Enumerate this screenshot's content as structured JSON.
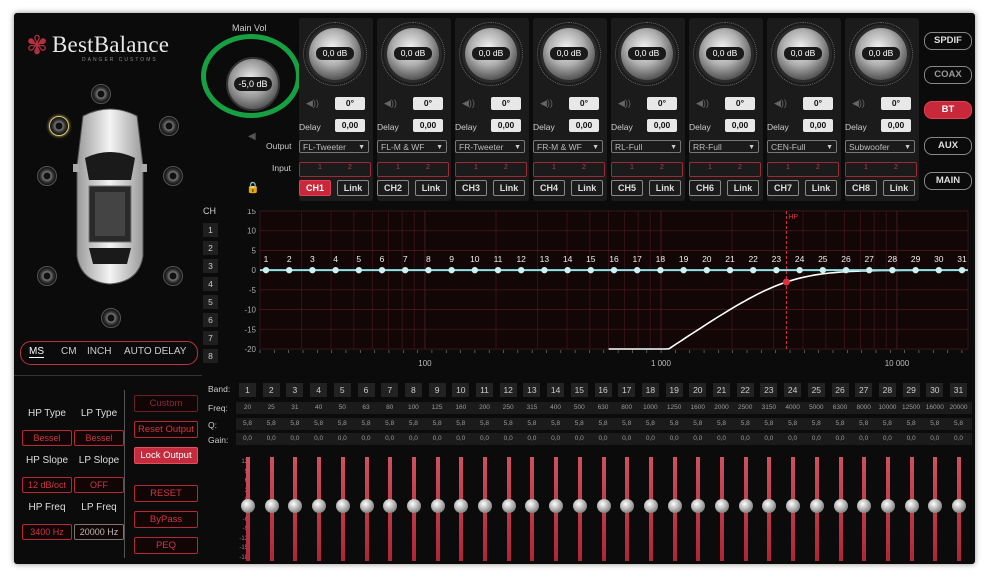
{
  "brand": {
    "name": "BestBalance",
    "sub": "DANGER CUSTOMS"
  },
  "main_vol": {
    "label": "Main Vol",
    "value": "-5,0 dB"
  },
  "row_labels": {
    "output": "Output",
    "input": "Input",
    "delay": "Delay"
  },
  "channels": [
    {
      "gain": "0,0 dB",
      "phase": "0°",
      "delay": "0,00",
      "output": "FL-Tweeter",
      "in1": "1",
      "in2": "2",
      "btn": "CH1",
      "link": "Link",
      "selected": true
    },
    {
      "gain": "0,0 dB",
      "phase": "0°",
      "delay": "0,00",
      "output": "FL-M & WF",
      "in1": "1",
      "in2": "2",
      "btn": "CH2",
      "link": "Link",
      "selected": false
    },
    {
      "gain": "0,0 dB",
      "phase": "0°",
      "delay": "0,00",
      "output": "FR-Tweeter",
      "in1": "1",
      "in2": "2",
      "btn": "CH3",
      "link": "Link",
      "selected": false
    },
    {
      "gain": "0,0 dB",
      "phase": "0°",
      "delay": "0,00",
      "output": "FR-M & WF",
      "in1": "1",
      "in2": "2",
      "btn": "CH4",
      "link": "Link",
      "selected": false
    },
    {
      "gain": "0,0 dB",
      "phase": "0°",
      "delay": "0,00",
      "output": "RL-Full",
      "in1": "1",
      "in2": "2",
      "btn": "CH5",
      "link": "Link",
      "selected": false
    },
    {
      "gain": "0,0 dB",
      "phase": "0°",
      "delay": "0,00",
      "output": "RR-Full",
      "in1": "1",
      "in2": "2",
      "btn": "CH6",
      "link": "Link",
      "selected": false
    },
    {
      "gain": "0,0 dB",
      "phase": "0°",
      "delay": "0,00",
      "output": "CEN-Full",
      "in1": "1",
      "in2": "2",
      "btn": "CH7",
      "link": "Link",
      "selected": false
    },
    {
      "gain": "0,0 dB",
      "phase": "0°",
      "delay": "0,00",
      "output": "Subwoofer",
      "in1": "1",
      "in2": "2",
      "btn": "CH8",
      "link": "Link",
      "selected": false
    }
  ],
  "sources": [
    {
      "label": "SPDIF",
      "state": "normal"
    },
    {
      "label": "COAX",
      "state": "dim"
    },
    {
      "label": "BT",
      "state": "on"
    },
    {
      "label": "AUX",
      "state": "normal"
    },
    {
      "label": "MAIN",
      "state": "normal"
    }
  ],
  "units": {
    "items": [
      "MS",
      "CM",
      "INCH",
      "AUTO DELAY"
    ],
    "selected": "MS"
  },
  "ch_column": {
    "label": "CH",
    "items": [
      "1",
      "2",
      "3",
      "4",
      "5",
      "6",
      "7",
      "8"
    ]
  },
  "filter": {
    "hp_type_label": "HP Type",
    "lp_type_label": "LP Type",
    "hp_type": "Bessel",
    "lp_type": "Bessel",
    "hp_slope_label": "HP Slope",
    "lp_slope_label": "LP Slope",
    "hp_slope": "12 dB/oct",
    "lp_slope": "OFF",
    "hp_freq_label": "HP Freq",
    "lp_freq_label": "LP Freq",
    "hp_freq": "3400 Hz",
    "lp_freq": "20000 Hz"
  },
  "actions": {
    "custom": "Custom",
    "reset_output": "Reset Output",
    "lock_output": "Lock Output",
    "reset": "RESET",
    "bypass": "ByPass",
    "peq": "PEQ"
  },
  "graph": {
    "y_ticks": [
      "15",
      "10",
      "5",
      "0",
      "-5",
      "-10",
      "-15",
      "-20"
    ],
    "x_ticks": [
      "100",
      "1 000",
      "10 000"
    ],
    "hp_label": "HP",
    "hp_freq": 3400,
    "band_points": [
      "1",
      "2",
      "3",
      "4",
      "5",
      "6",
      "7",
      "8",
      "9",
      "10",
      "11",
      "12",
      "13",
      "14",
      "15",
      "16",
      "17",
      "18",
      "19",
      "20",
      "21",
      "22",
      "23",
      "24",
      "25",
      "26",
      "27",
      "28",
      "29",
      "30",
      "31"
    ],
    "colors": {
      "grid": "#4a1a1f",
      "response": "#ffffff",
      "bands": "#8fe3e6",
      "marker": "#e03040"
    }
  },
  "eq": {
    "band_label": "Band:",
    "freq_label": "Freq:",
    "q_label": "Q:",
    "gain_label": "Gain:",
    "bands": [
      "1",
      "2",
      "3",
      "4",
      "5",
      "6",
      "7",
      "8",
      "9",
      "10",
      "11",
      "12",
      "13",
      "14",
      "15",
      "16",
      "17",
      "18",
      "19",
      "20",
      "21",
      "22",
      "23",
      "24",
      "25",
      "26",
      "27",
      "28",
      "29",
      "30",
      "31"
    ],
    "freqs": [
      "20",
      "25",
      "31",
      "40",
      "50",
      "63",
      "80",
      "100",
      "125",
      "160",
      "200",
      "250",
      "315",
      "400",
      "500",
      "630",
      "800",
      "1000",
      "1250",
      "1600",
      "2000",
      "2500",
      "3150",
      "4000",
      "5000",
      "6300",
      "8000",
      "10000",
      "12500",
      "16000",
      "20000"
    ],
    "q": [
      "5,8",
      "5,8",
      "5,8",
      "5,8",
      "5,8",
      "5,8",
      "5,8",
      "5,8",
      "5,8",
      "5,8",
      "5,8",
      "5,8",
      "5,8",
      "5,8",
      "5,8",
      "5,8",
      "5,8",
      "5,8",
      "5,8",
      "5,8",
      "5,8",
      "5,8",
      "5,8",
      "5,8",
      "5,8",
      "5,8",
      "5,8",
      "5,8",
      "5,8",
      "5,8",
      "5,8"
    ],
    "gain": [
      "0,0",
      "0,0",
      "0,0",
      "0,0",
      "0,0",
      "0,0",
      "0,0",
      "0,0",
      "0,0",
      "0,0",
      "0,0",
      "0,0",
      "0,0",
      "0,0",
      "0,0",
      "0,0",
      "0,0",
      "0,0",
      "0,0",
      "0,0",
      "0,0",
      "0,0",
      "0,0",
      "0,0",
      "0,0",
      "0,0",
      "0,0",
      "0,0",
      "0,0",
      "0,0",
      "0,0"
    ],
    "slider_scale": [
      "12",
      "9",
      "6",
      "3",
      "0",
      "-3",
      "-6",
      "-9",
      "-12",
      "-15",
      "-18"
    ]
  }
}
